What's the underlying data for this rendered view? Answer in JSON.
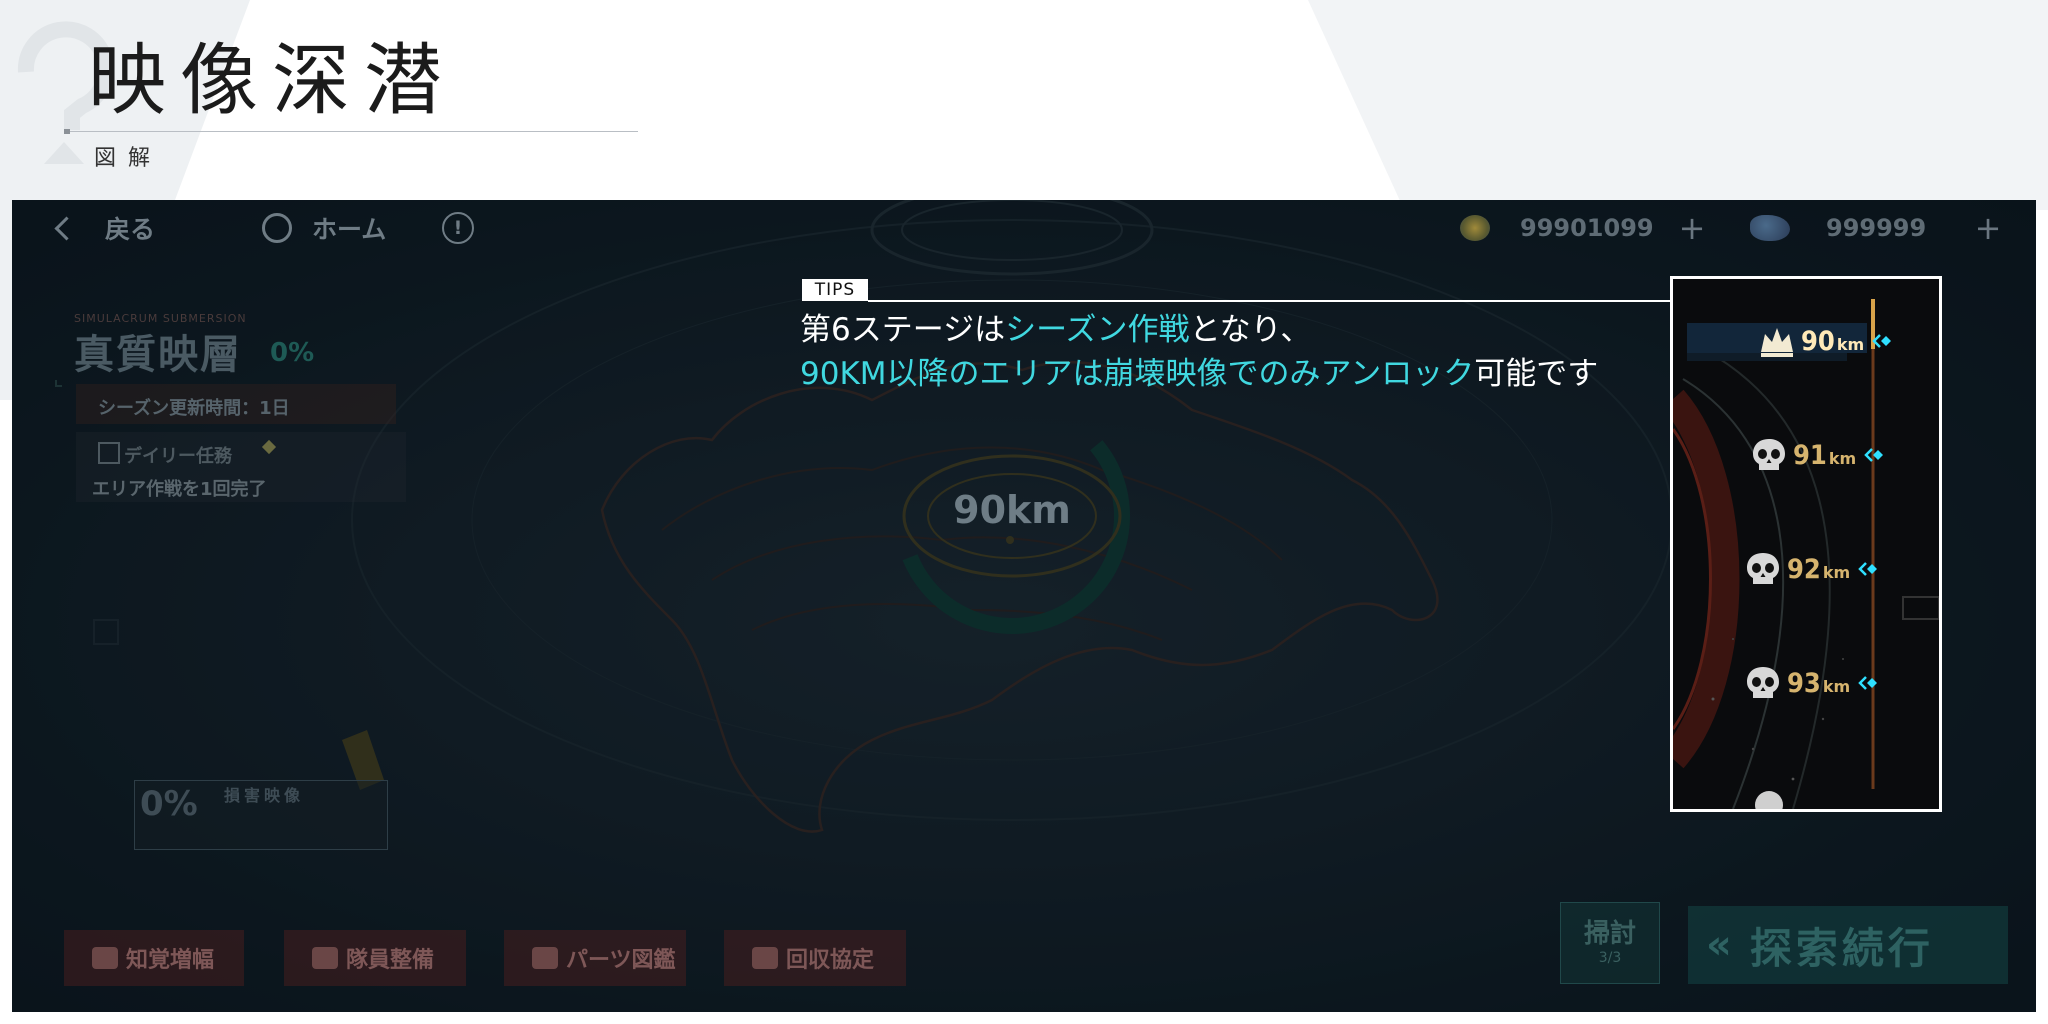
{
  "header": {
    "title": "映像深潜",
    "subtitle": "図解"
  },
  "game": {
    "topbar": {
      "back_label": "戻る",
      "home_label": "ホーム",
      "info_label": "!",
      "currency1": "99901099",
      "currency2": "999999"
    },
    "stage": {
      "tag": "SIMULACRUM SUBMERSION",
      "name": "真質映層",
      "progress": "0%",
      "season_update": "シーズン更新時間：1日",
      "daily_title": "デイリー任務",
      "daily_detail": "エリア作戦を1回完了"
    },
    "record": {
      "percent": "0%",
      "label": "損害映像"
    },
    "center_km": "90km",
    "bottom": {
      "btn1": "知覚増幅",
      "btn2": "隊員整備",
      "btn3": "パーツ図鑑",
      "btn4": "回収協定",
      "sweep_label": "掃討",
      "sweep_count": "3/3",
      "explore_label": "探索続行"
    },
    "tips": {
      "label": "TIPS",
      "line1_a": "第6ステージは",
      "line1_b": "シーズン作戦",
      "line1_c": "となり、",
      "line2_a": "90KM以降のエリアは崩壊映像でのみアンロック",
      "line2_b": "可能です"
    },
    "stage_list": [
      {
        "num": "90",
        "unit": "km",
        "icon": "crown-icon"
      },
      {
        "num": "91",
        "unit": "km",
        "icon": "skull-icon"
      },
      {
        "num": "92",
        "unit": "km",
        "icon": "skull-icon"
      },
      {
        "num": "93",
        "unit": "km",
        "icon": "skull-icon"
      }
    ]
  },
  "colors": {
    "highlight": "#40d8e0",
    "km_gold": "#d6b46e",
    "marker_cyan": "#2fe0ff"
  }
}
